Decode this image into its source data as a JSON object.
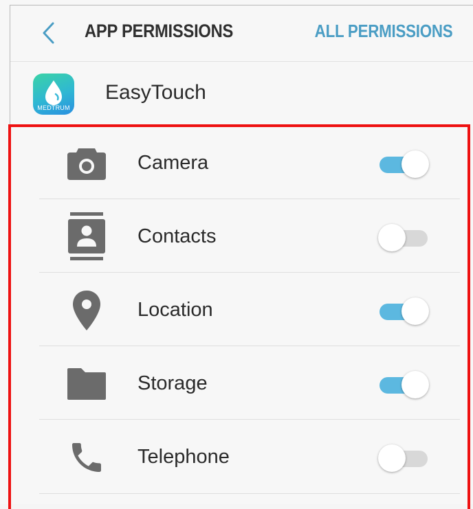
{
  "header": {
    "title": "APP PERMISSIONS",
    "action_label": "ALL PERMISSIONS"
  },
  "app": {
    "name": "EasyTouch",
    "icon_brand_text": "MEDTRUM",
    "icon": "water-drop-icon"
  },
  "colors": {
    "accent": "#4a9dc4",
    "toggle_on": "#5cb8e0",
    "toggle_off": "#d8d8d8",
    "highlight": "#ee1111"
  },
  "permissions": [
    {
      "label": "Camera",
      "icon": "camera-icon",
      "enabled": true
    },
    {
      "label": "Contacts",
      "icon": "contacts-icon",
      "enabled": false
    },
    {
      "label": "Location",
      "icon": "location-pin-icon",
      "enabled": true
    },
    {
      "label": "Storage",
      "icon": "folder-icon",
      "enabled": true
    },
    {
      "label": "Telephone",
      "icon": "phone-icon",
      "enabled": false
    }
  ]
}
